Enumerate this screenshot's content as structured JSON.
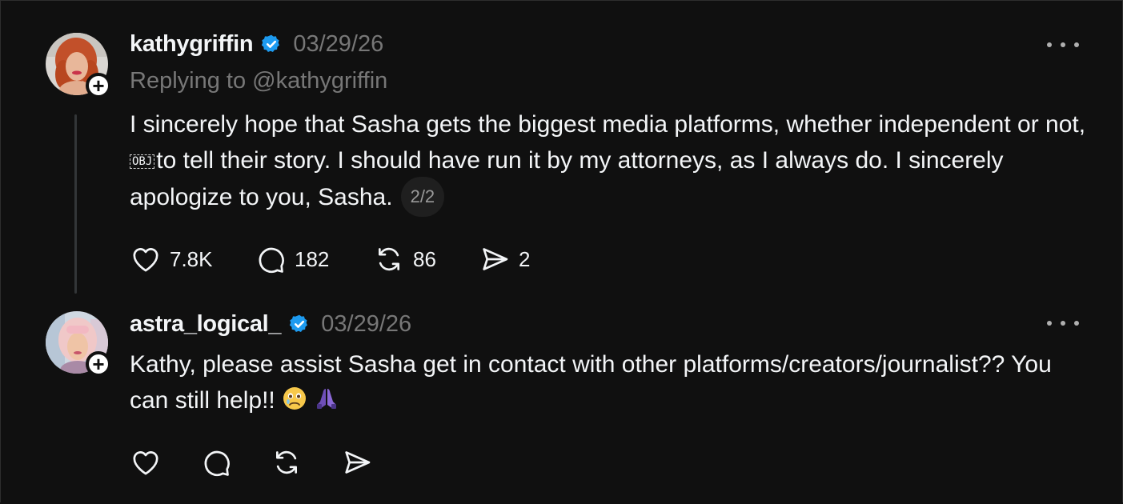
{
  "posts": [
    {
      "username": "kathygriffin",
      "timestamp": "03/29/26",
      "replying_to": "Replying to @kathygriffin",
      "text_before_obj": "I sincerely hope that Sasha gets the biggest media platforms, whether independent or not, ",
      "obj_marker": "OBJ",
      "text_after_obj": "to tell their story. I should have run it by my attorneys, as I always do. I sincerely apologize to you, Sasha.",
      "thread_count": "2/2",
      "likes": "7.8K",
      "comments": "182",
      "reposts": "86",
      "shares": "2"
    },
    {
      "username": "astra_logical_",
      "timestamp": "03/29/26",
      "text": "Kathy, please assist Sasha get in contact with other platforms/creators/journalist?? You can still help!!",
      "emojis": [
        "crying-face",
        "folded-hands"
      ]
    }
  ],
  "colors": {
    "background": "#101010",
    "text": "#f3f5f7",
    "muted": "#777777",
    "verified": "#1d9bf0"
  }
}
